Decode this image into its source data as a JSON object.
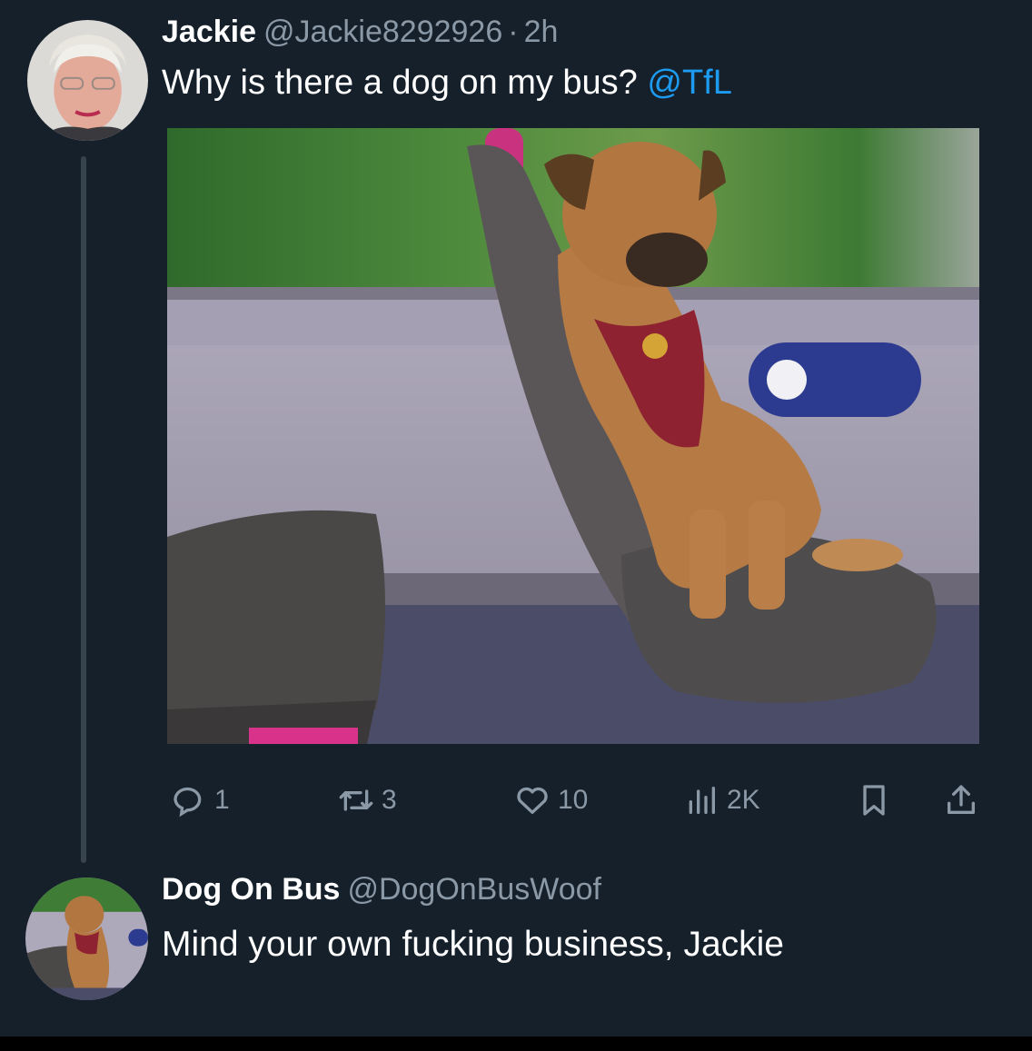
{
  "tweet": {
    "name": "Jackie",
    "handle": "@Jackie8292926",
    "separator": "·",
    "time": "2h",
    "text": "Why is there a dog on my bus?",
    "mention": "@TfL",
    "media_alt": "Dog sitting on a bus seat"
  },
  "actions": {
    "replies": "1",
    "retweets": "3",
    "likes": "10",
    "views": "2K"
  },
  "reply": {
    "name": "Dog On Bus",
    "handle": "@DogOnBusWoof",
    "text": "Mind your own fucking business, Jackie"
  },
  "colors": {
    "background": "#15202b",
    "accent": "#1d9bf0",
    "muted": "#8b98a5",
    "thread_line": "#38444d"
  },
  "icons": [
    "reply-icon",
    "retweet-icon",
    "like-icon",
    "views-icon",
    "bookmark-icon",
    "share-icon"
  ]
}
